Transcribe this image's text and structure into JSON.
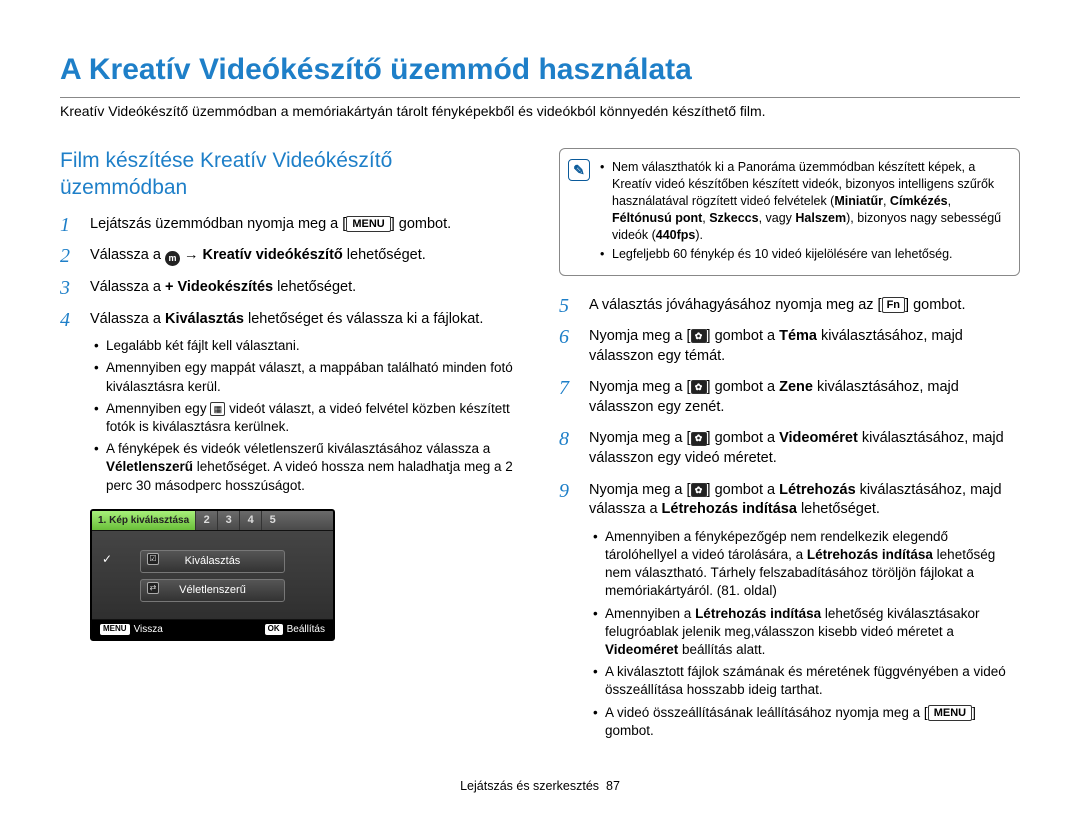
{
  "title": "A Kreatív Videókészítő üzemmód használata",
  "intro": "Kreatív Videókészítő üzemmódban a memóriakártyán tárolt fényképekből és videókból könnyedén készíthető film.",
  "section_title": "Film készítése Kreatív Videókészítő üzemmódban",
  "keys": {
    "menu": "MENU",
    "fn": "Fn"
  },
  "left_steps": {
    "s1_a": "Lejátszás üzemmódban nyomja meg a [",
    "s1_b": "] gombot.",
    "s2_a": "Válassza a ",
    "s2_b": " → ",
    "s2_c": "Kreatív videókészítő",
    "s2_d": " lehetőséget.",
    "s3_a": "Válassza a ",
    "s3_b": "+ Videokészítés",
    "s3_c": " lehetőséget.",
    "s4_a": "Válassza a ",
    "s4_b": "Kiválasztás",
    "s4_c": " lehetőséget és válassza ki a fájlokat.",
    "s4_bullets": [
      "Legalább két fájlt kell választani.",
      "Amennyiben egy mappát választ, a mappában található minden fotó kiválasztásra kerül.",
      {
        "pre": "Amennyiben egy ",
        "post": " videót választ, a videó felvétel közben készített fotók is kiválasztásra kerülnek."
      },
      {
        "pre": "A fényképek és videók véletlenszerű kiválasztásához válassza a ",
        "strong": "Véletlenszerű",
        "post": " lehetőséget. A videó hossza nem haladhatja meg a 2 perc 30 másodperc hosszúságot."
      }
    ]
  },
  "note": {
    "b1a": "Nem választhatók ki a Panoráma üzemmódban készített képek, a Kreatív videó készítőben készített videók, bizonyos intelligens szűrők használatával rögzített videó felvételek (",
    "b1_strong1": "Miniatűr",
    "b1_sep": ", ",
    "b1_strong2": "Címkézés",
    "b1_strong3": "Féltónusú pont",
    "b1_strong4": "Szkeccs",
    "b1_or": ", vagy ",
    "b1_strong5": "Halszem",
    "b1b": "), bizonyos nagy sebességű videók (",
    "b1_strong6": "440fps",
    "b1c": ").",
    "b2": "Legfeljebb 60 fénykép és 10 videó kijelölésére van lehetőség."
  },
  "right_steps": {
    "s5_a": "A választás jóváhagyásához nyomja meg az [",
    "s5_b": "] gombot.",
    "s6_a": "Nyomja meg a [",
    "s6_b": "] gombot a ",
    "s6_strong": "Téma",
    "s6_c": " kiválasztásához, majd válasszon egy témát.",
    "s7_a": "Nyomja meg a [",
    "s7_b": "] gombot a ",
    "s7_strong": "Zene",
    "s7_c": " kiválasztásához, majd válasszon egy zenét.",
    "s8_a": "Nyomja meg a [",
    "s8_b": "] gombot a ",
    "s8_strong": "Videoméret",
    "s8_c": " kiválasztásához, majd válasszon egy videó méretet.",
    "s9_a": "Nyomja meg a [",
    "s9_b": "] gombot a ",
    "s9_strong1": "Létrehozás",
    "s9_c": " kiválasztásához, majd válassza a ",
    "s9_strong2": "Létrehozás indítása",
    "s9_d": " lehetőséget.",
    "s9_bullets": {
      "b1a": "Amennyiben a fényképezőgép nem rendelkezik elegendő tárolóhellyel a videó tárolására, a ",
      "b1_strong": "Létrehozás indítása",
      "b1b": " lehetőség nem választható. Tárhely felszabadításához töröljön fájlokat a memóriakártyáról. (81. oldal)",
      "b2a": "Amennyiben a ",
      "b2_strong1": "Létrehozás indítása",
      "b2b": " lehetőség kiválasztásakor felugróablak jelenik meg,válasszon kisebb videó méretet a ",
      "b2_strong2": "Videoméret",
      "b2c": " beállítás alatt.",
      "b3": "A kiválasztott fájlok számának és méretének függvényében a videó összeállítása hosszabb ideig tarthat.",
      "b4a": "A videó összeállításának leállításához nyomja meg a [",
      "b4b": "] gombot."
    }
  },
  "screen": {
    "tab_active": "1. Kép kiválasztása",
    "tabs": [
      "2",
      "3",
      "4",
      "5"
    ],
    "select_label": "Kiválasztás",
    "random_label": "Véletlenszerű",
    "back_key": "MENU",
    "back_label": "Vissza",
    "set_key": "OK",
    "set_label": "Beállítás"
  },
  "footer": {
    "label": "Lejátszás és szerkesztés",
    "page": "87"
  }
}
